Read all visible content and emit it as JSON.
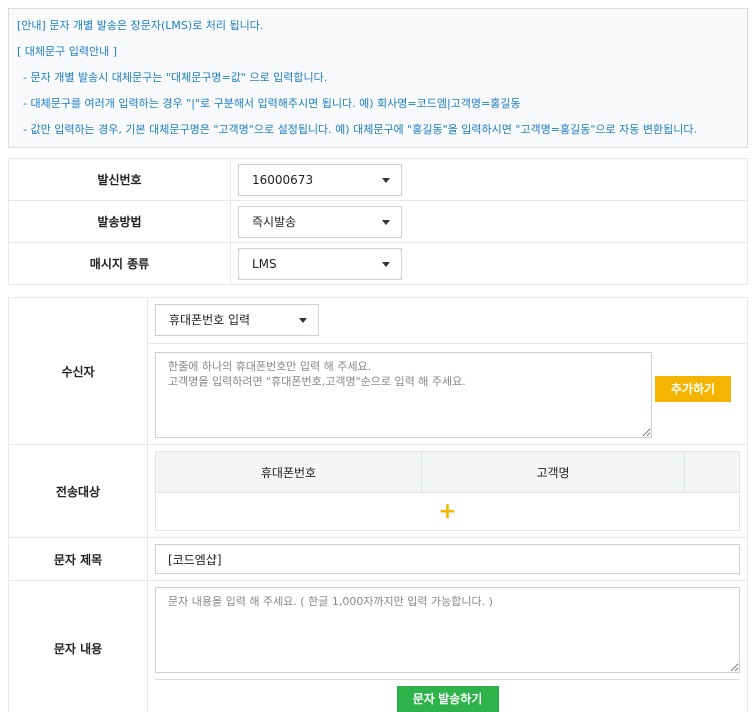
{
  "notice": {
    "line1": "[안내] 문자 개별 발송은 장문자(LMS)로 처리 됩니다.",
    "line2": "[ 대체문구 입력안내 ]",
    "line3": "- 문자 개별 발송시 대체문구는 \"대체문구명=값\" 으로 입력합니다.",
    "line4": "- 대체문구를 여러개 입력하는 경우 \"|\"로 구분해서 입력해주시면 됩니다. 예) 회사명=코드엠|고객명=홍길동",
    "line5": "- 값만 입력하는 경우, 기본 대체문구명은 \"고객명\"으로 설정됩니다. 예) 대체문구에 \"홍길동\"을 입력하시면 \"고객명=홍길동\"으로 자동 변환됩니다."
  },
  "settings": {
    "sender_label": "발신번호",
    "sender_value": "16000673",
    "method_label": "발송방법",
    "method_value": "즉시발송",
    "type_label": "매시지 종류",
    "type_value": "LMS"
  },
  "recipient": {
    "label": "수신자",
    "input_type": "휴대폰번호 입력",
    "textarea_placeholder": "한줄에 하나의 휴대폰번호만 입력 해 주세요.\n고객명을 입력하려면 \"휴대폰번호,고객명\"순으로 입력 해 주세요.",
    "add_button": "추가하기"
  },
  "targets": {
    "label": "전송대상",
    "col_phone": "휴대폰번호",
    "col_name": "고객명",
    "add_icon": "+"
  },
  "subject": {
    "label": "문자 제목",
    "value": "[코드엠샵]"
  },
  "content": {
    "label": "문자 내용",
    "placeholder": "문자 내용을 입력 해 주세요. ( 한글 1,000자까지만 입력 가능합니다. )",
    "send_button": "문자 발송하기"
  },
  "colors": {
    "notice_text": "#1f7ec2",
    "accent_yellow": "#f4b400",
    "accent_green": "#2db34a"
  }
}
